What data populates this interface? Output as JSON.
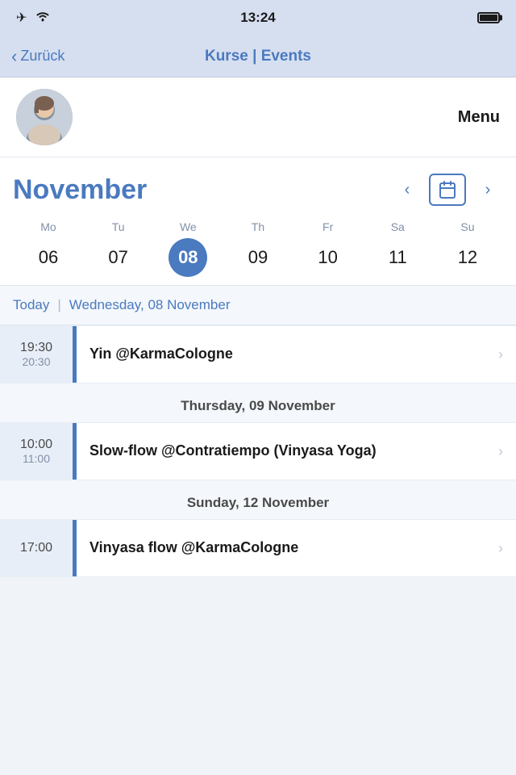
{
  "statusBar": {
    "time": "13:24",
    "icons": {
      "airplane": "✈",
      "wifi": "wifi",
      "battery": "battery"
    }
  },
  "navBar": {
    "backLabel": "Zurück",
    "title": "Kurse | Events"
  },
  "profileHeader": {
    "menuLabel": "Menu"
  },
  "calendar": {
    "monthTitle": "November",
    "prevLabel": "<",
    "nextLabel": ">",
    "days": [
      {
        "name": "Mo",
        "num": "06",
        "today": false
      },
      {
        "name": "Tu",
        "num": "07",
        "today": false
      },
      {
        "name": "We",
        "num": "08",
        "today": true
      },
      {
        "name": "Th",
        "num": "09",
        "today": false
      },
      {
        "name": "Fr",
        "num": "10",
        "today": false
      },
      {
        "name": "Sa",
        "num": "11",
        "today": false
      },
      {
        "name": "Su",
        "num": "12",
        "today": false
      }
    ]
  },
  "todayLabel": {
    "today": "Today",
    "pipe": "|",
    "date": "Wednesday, 08 November"
  },
  "events": [
    {
      "sectionDate": null,
      "timeStart": "19:30",
      "timeEnd": "20:30",
      "title": "Yin @KarmaCologne"
    },
    {
      "sectionDate": "Thursday, 09 November",
      "timeStart": "10:00",
      "timeEnd": "11:00",
      "title": "Slow-flow @Contratiempo (Vinyasa Yoga)"
    },
    {
      "sectionDate": "Sunday, 12 November",
      "timeStart": "17:00",
      "timeEnd": null,
      "title": "Vinyasa flow @KarmaCologne"
    }
  ]
}
